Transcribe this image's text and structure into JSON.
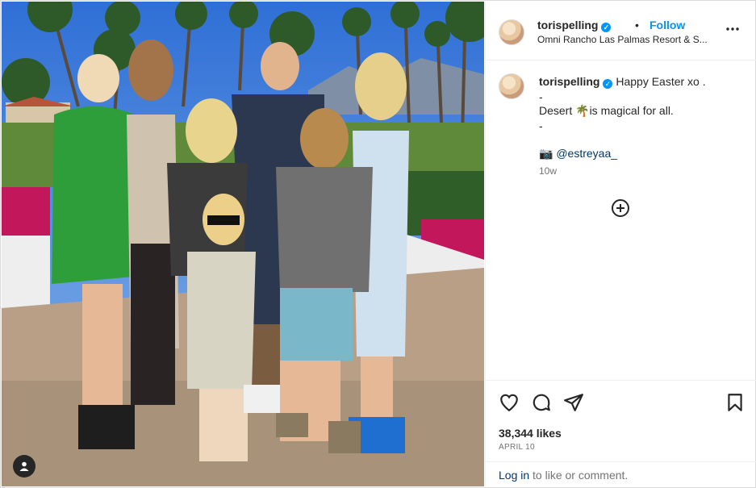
{
  "post": {
    "username": "torispelling",
    "follow_label": "Follow",
    "separator": "•",
    "location": "Omni Rancho Las Palmas Resort & S...",
    "verified_glyph": "✓"
  },
  "caption": {
    "username": "torispelling",
    "line1_text": "Happy Easter xo .",
    "line2": "-",
    "line3_prefix": "Desert ",
    "line3_emoji": "🌴",
    "line3_suffix": "is magical for all.",
    "line4": "-",
    "credit_emoji": "📷",
    "credit_mention": "@estreyaa_",
    "time_ago": "10w"
  },
  "stats": {
    "likes": "38,344 likes",
    "date": "APRIL 10"
  },
  "login": {
    "link": "Log in",
    "rest": " to like or comment."
  },
  "icons": {
    "more": "more-options-icon",
    "add_comment": "add-circle-icon",
    "like": "heart-icon",
    "comment": "comment-icon",
    "share": "share-icon",
    "save": "bookmark-icon",
    "tagged_user": "user-tag-icon"
  },
  "colors": {
    "accent": "#0095f6",
    "link": "#00376b",
    "muted": "#737373"
  }
}
